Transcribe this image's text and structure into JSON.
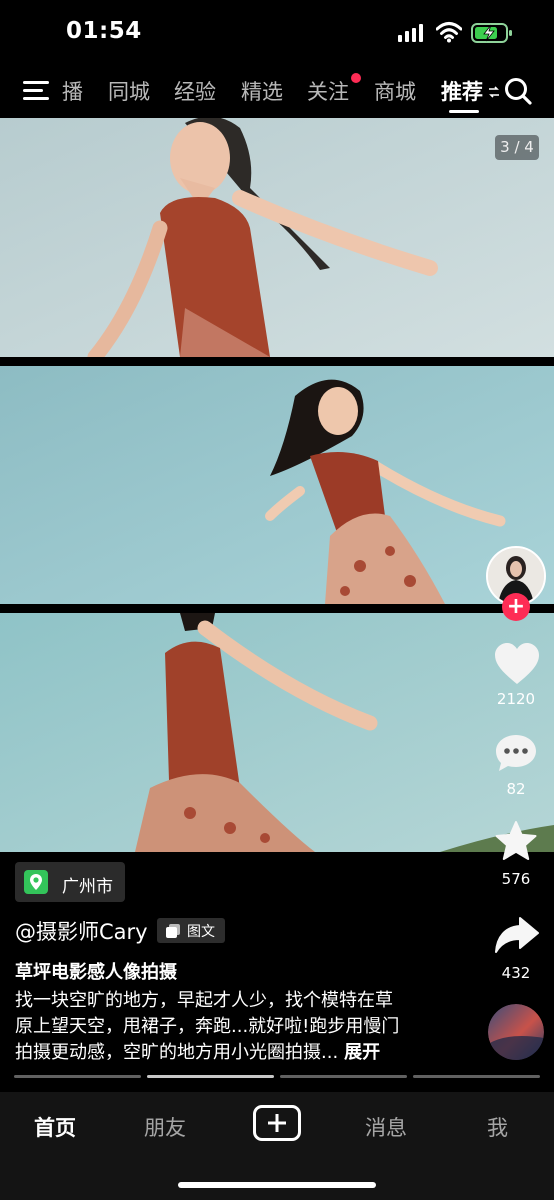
{
  "status_bar": {
    "time": "01:54",
    "battery_charging": true
  },
  "top_nav": {
    "tabs": [
      {
        "label": "播",
        "active": false
      },
      {
        "label": "同城",
        "active": false
      },
      {
        "label": "经验",
        "active": false
      },
      {
        "label": "精选",
        "active": false
      },
      {
        "label": "关注",
        "active": false,
        "has_dot": true
      },
      {
        "label": "商城",
        "active": false
      },
      {
        "label": "推荐",
        "active": true
      }
    ]
  },
  "post": {
    "photo_counter": "3 / 4",
    "location": "广州市",
    "author": "@摄影师Cary",
    "type_tag": "图文",
    "title": "草坪电影感人像拍摄",
    "desc_line1": "找一块空旷的地方，早起才人少，找个模特在草",
    "desc_line2": "原上望天空，甩裙子，奔跑...就好啦!跑步用慢门",
    "desc_line3": "拍摄更动感，空旷的地方用小光圈拍摄...",
    "expand_label": "展开",
    "page_count": 4,
    "current_page": 1
  },
  "actions": {
    "likes": "2120",
    "comments": "82",
    "favorites": "576",
    "shares": "432"
  },
  "bottom_tabs": {
    "home": "首页",
    "friends": "朋友",
    "messages": "消息",
    "me": "我"
  },
  "colors": {
    "accent_red": "#fe2c55",
    "location_green": "#33c45a",
    "sky": "#9fc4c9",
    "dress": "#9e3f2a"
  }
}
